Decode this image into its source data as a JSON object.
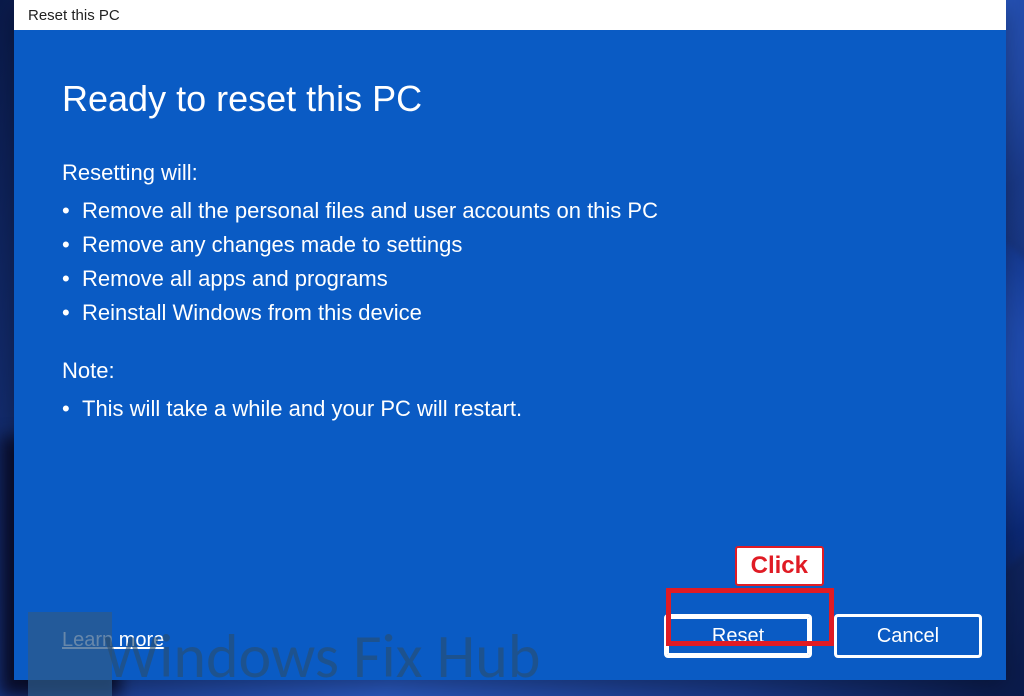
{
  "dialog": {
    "title": "Reset this PC",
    "heading": "Ready to reset this PC",
    "resetting_label": "Resetting will:",
    "reset_bullets": [
      "Remove all the personal files and user accounts on this PC",
      "Remove any changes made to settings",
      "Remove all apps and programs",
      "Reinstall Windows from this device"
    ],
    "note_label": "Note:",
    "note_bullets": [
      "This will take a while and your PC will restart."
    ],
    "learn_more": "Learn more",
    "reset_button": "Reset",
    "cancel_button": "Cancel"
  },
  "annotation": {
    "click_label": "Click"
  },
  "watermark": {
    "text": "Windows Fix Hub"
  },
  "colors": {
    "dialog_blue": "#0a5bc4",
    "highlight_red": "#e01b24"
  }
}
